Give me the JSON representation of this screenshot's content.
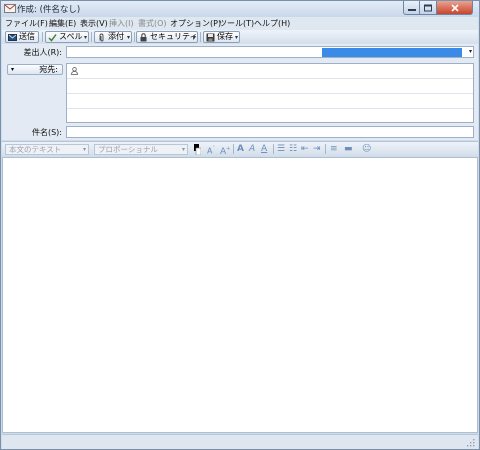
{
  "window": {
    "title": "作成: (件名なし)"
  },
  "menu": [
    {
      "label": "ファイル(F)",
      "disabled": false
    },
    {
      "label": "編集(E)",
      "disabled": false
    },
    {
      "label": "表示(V)",
      "disabled": false
    },
    {
      "label": "挿入(I)",
      "disabled": true
    },
    {
      "label": "書式(O)",
      "disabled": true
    },
    {
      "label": "オプション(P)",
      "disabled": false
    },
    {
      "label": "ツール(T)",
      "disabled": false
    },
    {
      "label": "ヘルプ(H)",
      "disabled": false
    }
  ],
  "toolbar": {
    "send": "送信",
    "spell": "スペル",
    "attach": "添付",
    "security": "セキュリティ",
    "save": "保存"
  },
  "header": {
    "from_label": "差出人(R):",
    "to_type": "宛先:",
    "subject_label": "件名(S):",
    "subject_value": ""
  },
  "format": {
    "paragraph_style": "本文のテキスト",
    "font": "プロポーショナル",
    "text_color": "#000000",
    "bg_color": "#ffffff"
  },
  "colors": {
    "accent": "#3a8ae8",
    "chrome": "#cfdcec"
  }
}
